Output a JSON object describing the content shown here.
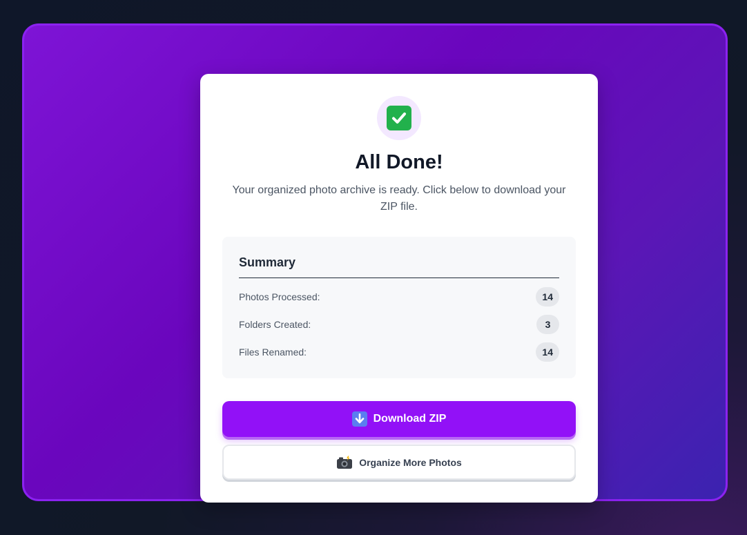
{
  "success": {
    "icon": "check-mark-icon",
    "title": "All Done!",
    "message": "Your organized photo archive is ready. Click below to download your ZIP file."
  },
  "summary": {
    "heading": "Summary",
    "rows": [
      {
        "label": "Photos Processed:",
        "value": "14"
      },
      {
        "label": "Folders Created:",
        "value": "3"
      },
      {
        "label": "Files Renamed:",
        "value": "14"
      }
    ]
  },
  "actions": {
    "download_label": "Download ZIP",
    "download_icon": "down-arrow-icon",
    "organize_label": "Organize More Photos",
    "organize_icon": "camera-flash-icon"
  },
  "colors": {
    "primary": "#9211f7",
    "success": "#22b14c",
    "frame_border": "#8b22f0"
  }
}
